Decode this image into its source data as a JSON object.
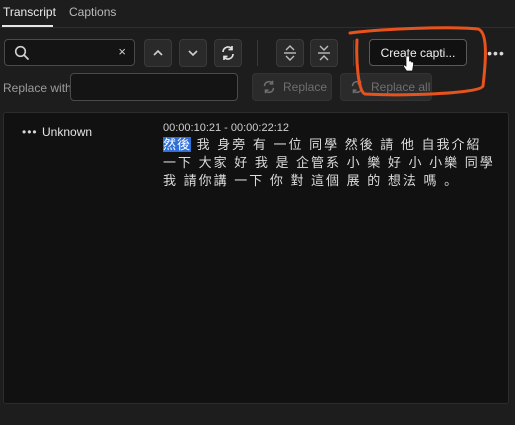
{
  "tabs": [
    {
      "label": "Transcript",
      "active": true
    },
    {
      "label": "Captions",
      "active": false
    }
  ],
  "search": {
    "value": "",
    "placeholder": "",
    "clear_glyph": "×"
  },
  "toolbar": {
    "icons": [
      "search-icon",
      "chevron-up-icon",
      "chevron-down-icon",
      "sync-icon",
      "expand-icon",
      "collapse-icon"
    ],
    "create_label": "Create capti...",
    "more_glyph": "•••"
  },
  "replace": {
    "label": "Replace with:",
    "value": "",
    "replace_label": "Replace",
    "replace_all_label": "Replace all"
  },
  "segment": {
    "speaker_menu_glyph": "•••",
    "speaker": "Unknown",
    "timecode": "00:00:10:21 - 00:00:22:12",
    "highlighted_text": "然後",
    "text_rest": "我 身旁 有 一位 同學 然後 請 他 自我介紹 一下 大家 好 我 是 企管系 小 樂 好 小 小樂 同學 我 請你講 一下 你 對 這個 展 的 想法 嗎 。"
  },
  "colors": {
    "background": "#1d1d1d",
    "panel": "#111111",
    "highlight": "#2f6fd9",
    "annotation": "#e8531d"
  }
}
